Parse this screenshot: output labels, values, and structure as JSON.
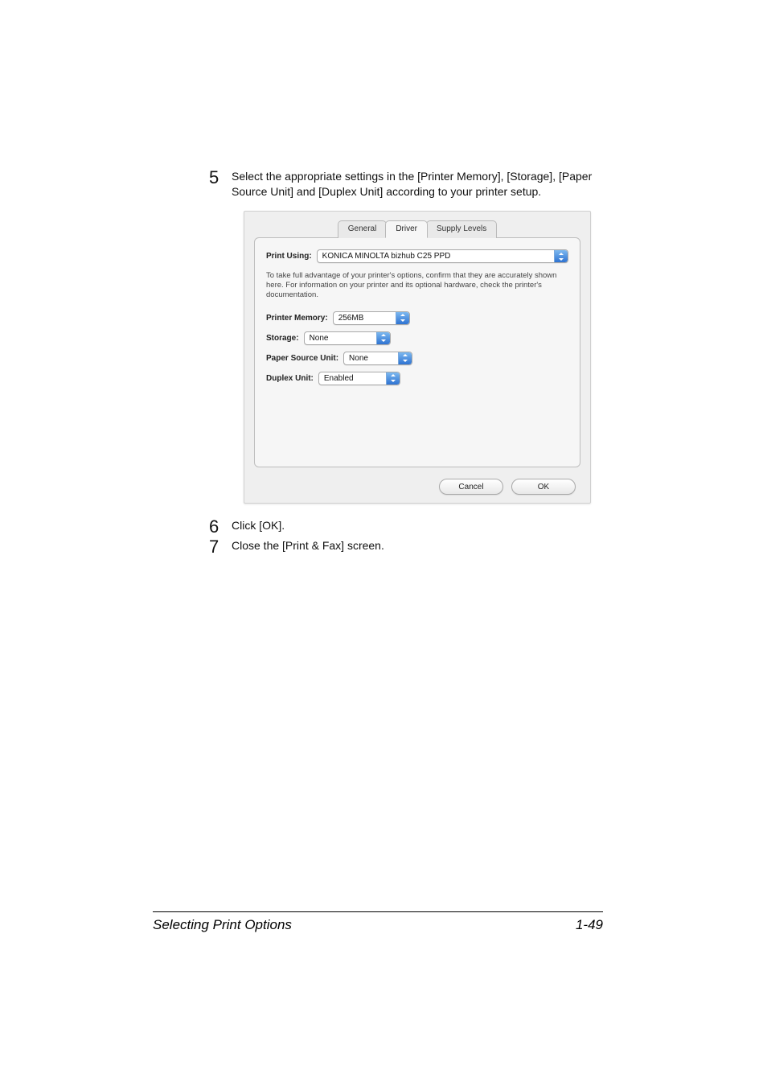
{
  "steps": {
    "s5": {
      "num": "5",
      "text": "Select the appropriate settings in the [Printer Memory], [Storage], [Paper Source Unit] and [Duplex Unit] according to your printer setup."
    },
    "s6": {
      "num": "6",
      "text": "Click [OK]."
    },
    "s7": {
      "num": "7",
      "text": "Close the [Print & Fax] screen."
    }
  },
  "dialog": {
    "tabs": {
      "general": "General",
      "driver": "Driver",
      "supply": "Supply Levels"
    },
    "print_using_label": "Print Using:",
    "print_using_value": "KONICA MINOLTA bizhub C25 PPD",
    "help_text": "To take full advantage of your printer's options, confirm that they are accurately shown here. For information on your printer and its optional hardware, check the printer's documentation.",
    "options": {
      "printer_memory": {
        "label": "Printer Memory:",
        "value": "256MB"
      },
      "storage": {
        "label": "Storage:",
        "value": "None"
      },
      "paper_source": {
        "label": "Paper Source Unit:",
        "value": "None"
      },
      "duplex": {
        "label": "Duplex Unit:",
        "value": "Enabled"
      }
    },
    "buttons": {
      "cancel": "Cancel",
      "ok": "OK"
    }
  },
  "footer": {
    "section": "Selecting Print Options",
    "page": "1-49"
  }
}
